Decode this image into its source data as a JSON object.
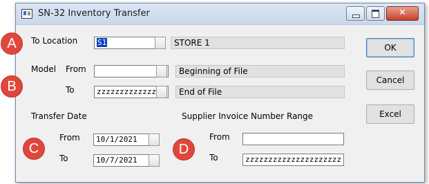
{
  "window": {
    "title": "SN-32  Inventory Transfer",
    "close_glyph": "✕"
  },
  "location": {
    "label": "To Location",
    "value": "S1",
    "description": "STORE 1"
  },
  "model": {
    "label": "Model",
    "from_label": "From",
    "from_value": "",
    "from_description": "Beginning of File",
    "to_label": "To",
    "to_value": "zzzzzzzzzzzzzzz",
    "to_description": "End of File"
  },
  "transfer_date": {
    "heading": "Transfer Date",
    "from_label": "From",
    "from_value": "10/1/2021",
    "to_label": "To",
    "to_value": "10/7/2021"
  },
  "supplier_invoice": {
    "heading": "Supplier Invoice Number Range",
    "from_label": "From",
    "from_value": "",
    "to_label": "To",
    "to_value": "zzzzzzzzzzzzzzzzzzzzz"
  },
  "buttons": {
    "ok": "OK",
    "cancel": "Cancel",
    "excel": "Excel"
  },
  "markers": [
    "A",
    "B",
    "C",
    "D"
  ],
  "colors": {
    "marker": "#e0473c",
    "selection": "#0a3fbf"
  }
}
